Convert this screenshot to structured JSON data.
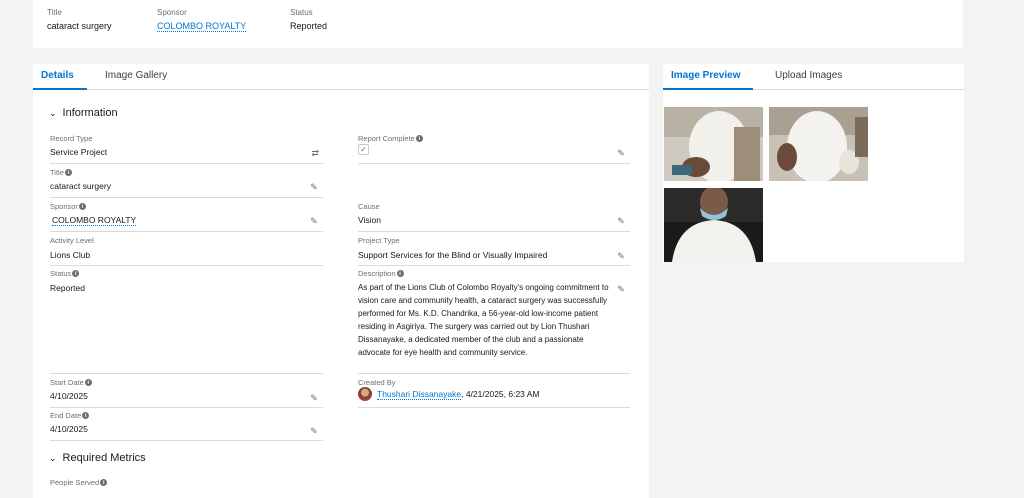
{
  "highlights": {
    "title_label": "Title",
    "title_value": "cataract surgery",
    "sponsor_label": "Sponsor",
    "sponsor_value": "COLOMBO ROYALTY",
    "status_label": "Status",
    "status_value": "Reported"
  },
  "left_tabs": {
    "details": "Details",
    "gallery": "Image Gallery"
  },
  "sections": {
    "information": "Information",
    "required_metrics": "Required Metrics"
  },
  "fields": {
    "record_type_label": "Record Type",
    "record_type_value": "Service Project",
    "report_complete_label": "Report Complete",
    "title_label": "Title",
    "title_value": "cataract surgery",
    "sponsor_label": "Sponsor",
    "sponsor_value": "COLOMBO ROYALTY",
    "cause_label": "Cause",
    "cause_value": "Vision",
    "activity_level_label": "Activity Level",
    "activity_level_value": "Lions Club",
    "project_type_label": "Project Type",
    "project_type_value": "Support Services for the Blind or Visually Impaired",
    "status_label": "Status",
    "status_value": "Reported",
    "description_label": "Description",
    "description_value": "As part of the Lions Club of Colombo Royalty's ongoing commitment to vision care and community health, a cataract surgery was successfully performed for Ms. K.D. Chandrika, a 56-year-old low-income patient residing in Asgiriya. The surgery was carried out by Lion Thushari Dissanayake, a dedicated member of the club and a passionate advocate for eye health and community service.",
    "start_date_label": "Start Date",
    "start_date_value": "4/10/2025",
    "end_date_label": "End Date",
    "end_date_value": "4/10/2025",
    "created_by_label": "Created By",
    "created_by_name": "Thushari Dissanayake",
    "created_by_time": ", 4/21/2025, 6:23 AM",
    "people_served_label": "People Served"
  },
  "right_tabs": {
    "preview": "Image Preview",
    "upload": "Upload Images"
  },
  "icons": {
    "info": "info-icon",
    "pencil": "pencil-icon",
    "swap": "swap-icon",
    "chevron": "chevron-down-icon",
    "check": "checkmark-icon"
  },
  "colors": {
    "link": "#0176d3",
    "tab_active": "#0176d3",
    "background": "#f3f3f3"
  }
}
